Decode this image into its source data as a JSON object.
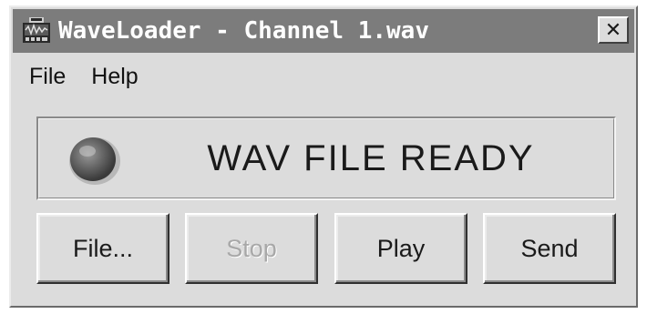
{
  "window": {
    "title": "WaveLoader - Channel 1.wav",
    "app_icon": "waveloader-app-icon",
    "close_icon": "close-icon",
    "close_glyph": "✕"
  },
  "menubar": {
    "items": [
      {
        "label": "File"
      },
      {
        "label": "Help"
      }
    ]
  },
  "status": {
    "text": "WAV FILE READY",
    "indicator_icon": "status-led-icon",
    "indicator_state": "off"
  },
  "buttons": {
    "file": {
      "label": "File...",
      "enabled": true
    },
    "stop": {
      "label": "Stop",
      "enabled": false
    },
    "play": {
      "label": "Play",
      "enabled": true
    },
    "send": {
      "label": "Send",
      "enabled": true
    }
  },
  "colors": {
    "titlebar": "#7c7c7c",
    "window_face": "#dcdcdc",
    "disabled_text": "#a8a8a8"
  }
}
